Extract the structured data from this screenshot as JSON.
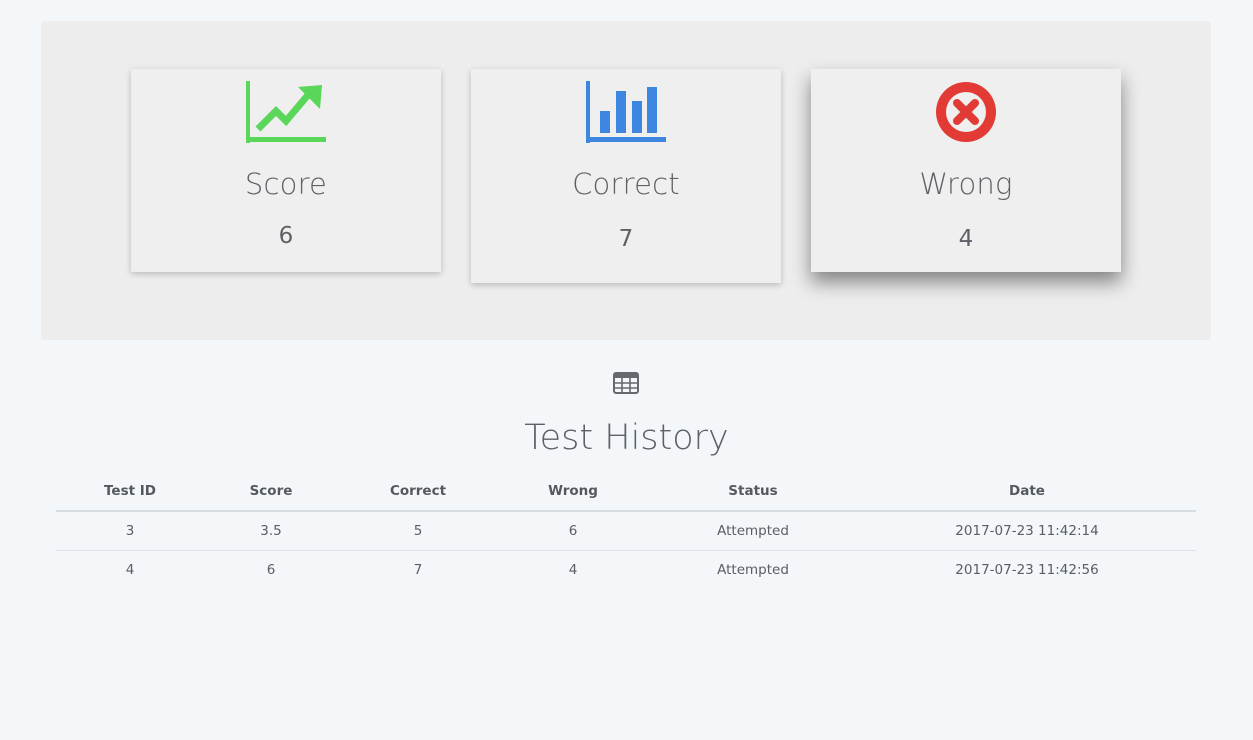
{
  "stats": {
    "score": {
      "icon": "trend-chart-icon",
      "label": "Score",
      "value": "6",
      "color": "#5ad65a"
    },
    "correct": {
      "icon": "bar-chart-icon",
      "label": "Correct",
      "value": "7",
      "color": "#3d87e0"
    },
    "wrong": {
      "icon": "times-circle-icon",
      "label": "Wrong",
      "value": "4",
      "color": "#e23b35"
    }
  },
  "history": {
    "icon": "table-icon",
    "title": "Test History",
    "columns": [
      "Test ID",
      "Score",
      "Correct",
      "Wrong",
      "Status",
      "Date"
    ],
    "rows": [
      [
        "3",
        "3.5",
        "5",
        "6",
        "Attempted",
        "2017-07-23 11:42:14"
      ],
      [
        "4",
        "6",
        "7",
        "4",
        "Attempted",
        "2017-07-23 11:42:56"
      ]
    ]
  }
}
